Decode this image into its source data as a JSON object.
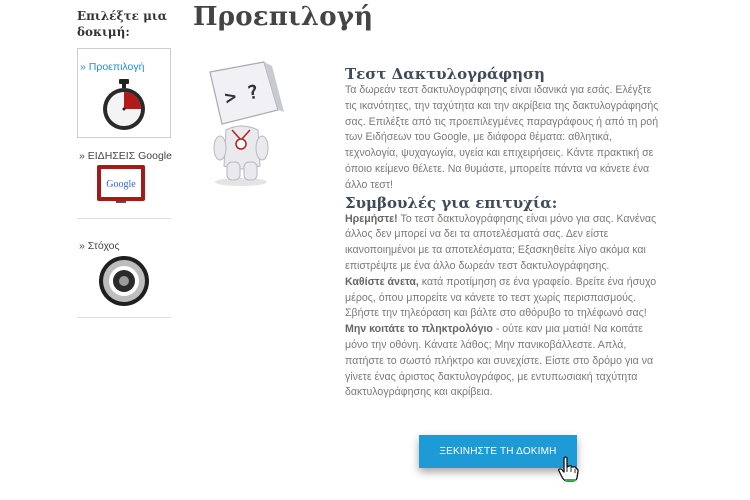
{
  "sidebar": {
    "title": "Επιλέξτε μια δοκιμή:",
    "items": [
      {
        "label": "» Προεπιλογή",
        "icon": "stopwatch-icon",
        "active": true
      },
      {
        "label": "» ΕΙΔΗΣΕΙΣ Google",
        "icon": "google-tv-icon",
        "active": false
      },
      {
        "label": "» Στόχος",
        "icon": "target-icon",
        "active": false
      }
    ]
  },
  "main": {
    "title": "Προεπιλογή",
    "section1_title": "Τεστ Δακτυλογράφηση",
    "section1_text": "Τα δωρεάν τεστ δακτυλογράφησης είναι ιδανικά για εσάς. Ελέγξτε τις ικανότητες, την ταχύτητα και την ακρίβεια της δακτυλογράφησής σας. Επιλέξτε από τις προεπιλεγμένες παραγράφους ή από τη ροή των Ειδήσεων του Google, με διάφορα θέματα: αθλητικά, τεχνολογία, ψυχαγωγία, υγεία και επιχειρήσεις. Κάντε πρακτική σε όποιο κείμενο θέλετε. Να θυμάστε, μπορείτε πάντα να κάνετε ένα άλλο τεστ!",
    "section2_title": "Συμβουλές για επιτυχία:",
    "tip1_bold": "Ηρεμήστε!",
    "tip1_text": " Το τεστ δακτυλογράφησης είναι μόνο για σας. Κανένας άλλος δεν μπορεί να δει τα αποτελέσματά σας. Δεν είστε ικανοποιημένοι με τα αποτελέσματα; Εξασκηθείτε λίγο ακόμα και επιστρέψτε με ένα άλλο δωρεάν τεστ δακτυλογράφησης.",
    "tip2_bold": "Καθίστε άνετα,",
    "tip2_text": " κατά προτίμηση σε ένα γραφείο. Βρείτε ένα ήσυχο μέρος, όπου μπορείτε να κάνετε το τεστ χωρίς περισπασμούς. Σβήστε την τηλεόραση και βάλτε στο αθόρυβο το τηλέφωνό σας!",
    "tip3_bold": "Μην κοιτάτε το πληκτρολόγιο",
    "tip3_text": " - ούτε καν μια ματιά! Να κοιτάτε μόνο την οθόνη. Κάνατε λάθος; Μην πανικοβάλλεστε. Απλά, πατήστε το σωστό πλήκτρο και συνεχίστε. Είστε στο δρόμο για να γίνετε ένας άριστος δακτυλογράφος, με εντυπωσιακή ταχύτητα δακτυλογράφησης και ακρίβεια.",
    "start_button": "ΞΕΚΙΝΗΣΤΕ ΤΗ ΔΟΚΙΜΗ",
    "mascot_screen_text": "> ?"
  },
  "google_tv_logo": "Google",
  "colors": {
    "accent": "#1e9bd7",
    "link": "#1a8fd6",
    "stopwatch": "#b31b1b"
  }
}
